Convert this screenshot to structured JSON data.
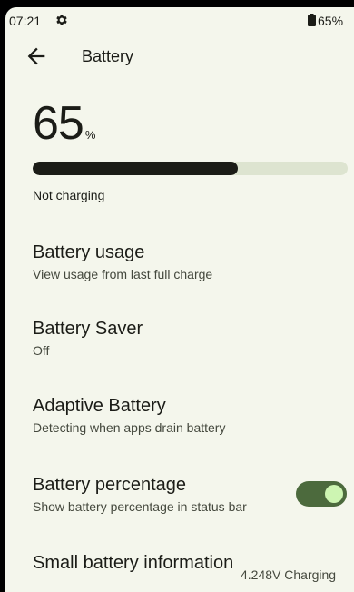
{
  "status_bar": {
    "time": "07:21",
    "settings_icon": "gear-icon",
    "battery_icon": "battery-icon",
    "battery_percent": "65%"
  },
  "toolbar": {
    "back_icon": "arrow-back-icon",
    "title": "Battery"
  },
  "battery": {
    "level": "65",
    "unit": "%",
    "level_fraction": 0.65,
    "charging_status": "Not charging"
  },
  "preferences": [
    {
      "title": "Battery usage",
      "summary": "View usage from last full charge"
    },
    {
      "title": "Battery Saver",
      "summary": "Off"
    },
    {
      "title": "Adaptive Battery",
      "summary": "Detecting when apps drain battery"
    },
    {
      "title": "Battery percentage",
      "summary": "Show battery percentage in status bar",
      "toggle_on": true
    }
  ],
  "small_battery_info": {
    "title": "Small battery information",
    "value": "4.248V Charging"
  },
  "colors": {
    "background": "#F4F6EC",
    "text": "#1B1C17",
    "progress_fill": "#1B1C17",
    "progress_track": "#DDE4D0",
    "toggle_track_on": "#4C6A3D",
    "toggle_thumb_on": "#CDF5B2"
  }
}
